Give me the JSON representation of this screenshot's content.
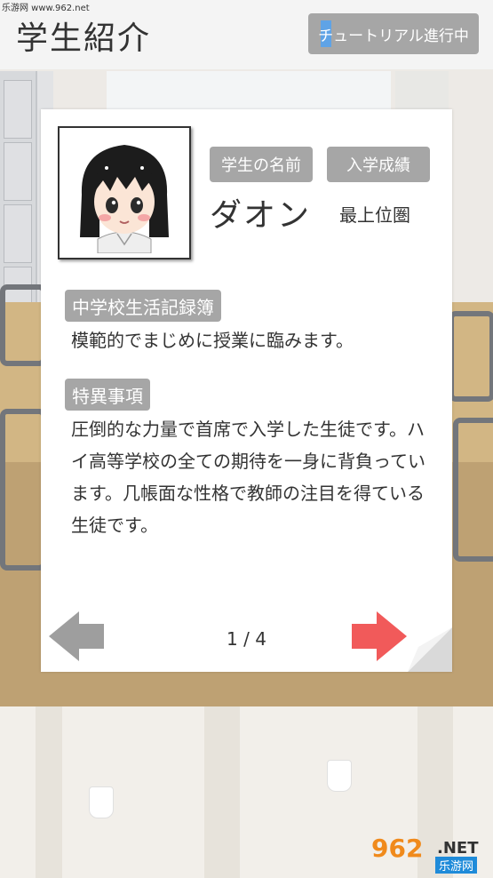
{
  "watermark_top": "乐游网 www.962.net",
  "header": {
    "title": "学生紹介",
    "tutorial_button": "チュートリアル進行中"
  },
  "profile": {
    "name_label": "学生の名前",
    "grade_label": "入学成績",
    "name": "ダオン",
    "grade": "最上位圏"
  },
  "sections": [
    {
      "label": "中学校生活記録簿",
      "text": "模範的でまじめに授業に臨みます。"
    },
    {
      "label": "特異事項",
      "text": "圧倒的な力量で首席で入学した生徒です。ハイ高等学校の全ての期待を一身に背負っています。几帳面な性格で教師の注目を得ている生徒です。"
    }
  ],
  "pager": {
    "text": "1 / 4"
  },
  "logo": {
    "number": "962",
    "suffix": ".NET",
    "sub": "乐游网"
  },
  "colors": {
    "tag_gray": "#a6a6a6",
    "next_arrow": "#f15a5a",
    "prev_arrow": "#9e9e9e",
    "tutorial_highlight": "#5fa3e6"
  },
  "icons": {
    "prev": "left-arrow-icon",
    "next": "right-arrow-icon"
  }
}
